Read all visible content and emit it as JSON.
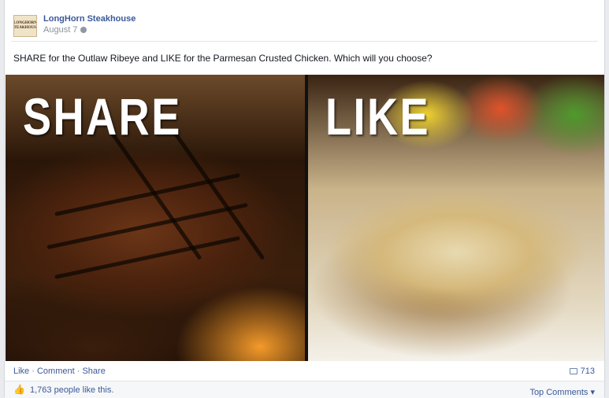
{
  "post": {
    "page_name": "LongHorn Steakhouse",
    "logo_text": "LONGHORN STEAKHOUSE",
    "date": "August 7",
    "privacy_icon": "globe-icon",
    "text": "SHARE for the Outlaw Ribeye and LIKE for the Parmesan Crusted Chicken. Which will you choose?"
  },
  "photo": {
    "left_word": "SHARE",
    "right_word": "LIKE"
  },
  "actions": {
    "like": "Like",
    "comment": "Comment",
    "share": "Share",
    "separator": "·",
    "comment_count": "713"
  },
  "footer": {
    "likes_text": "1,763 people like this.",
    "top_comments": "Top Comments ▾",
    "like_icon": "thumbs-up-icon"
  },
  "colors": {
    "link": "#3b5998",
    "meta": "#89919c"
  }
}
